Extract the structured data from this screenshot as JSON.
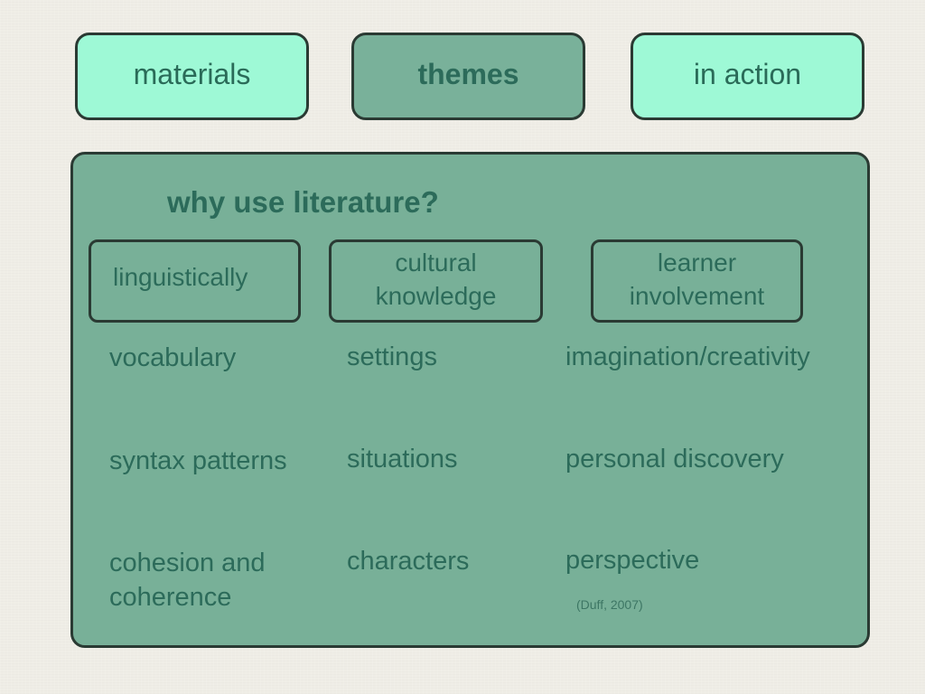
{
  "nav": {
    "tabs": [
      {
        "label": "materials",
        "active": false
      },
      {
        "label": "themes",
        "active": true
      },
      {
        "label": "in action",
        "active": false
      }
    ]
  },
  "panel": {
    "title": "why use literature?",
    "categories": [
      {
        "label": "linguistically",
        "items": [
          "vocabulary",
          "syntax patterns",
          "cohesion and\ncoherence"
        ]
      },
      {
        "label": "cultural\nknowledge",
        "items": [
          "settings",
          "situations",
          "characters"
        ]
      },
      {
        "label": "learner\ninvolvement",
        "items": [
          "imagination/creativity",
          "personal discovery",
          "perspective"
        ]
      }
    ],
    "citation": "(Duff, 2007)"
  },
  "colors": {
    "background": "#efede6",
    "nav_inactive": "#9ef9d6",
    "nav_active": "#79b19a",
    "panel": "#78b098",
    "border": "#2a3a33",
    "text": "#2c6b5a"
  }
}
